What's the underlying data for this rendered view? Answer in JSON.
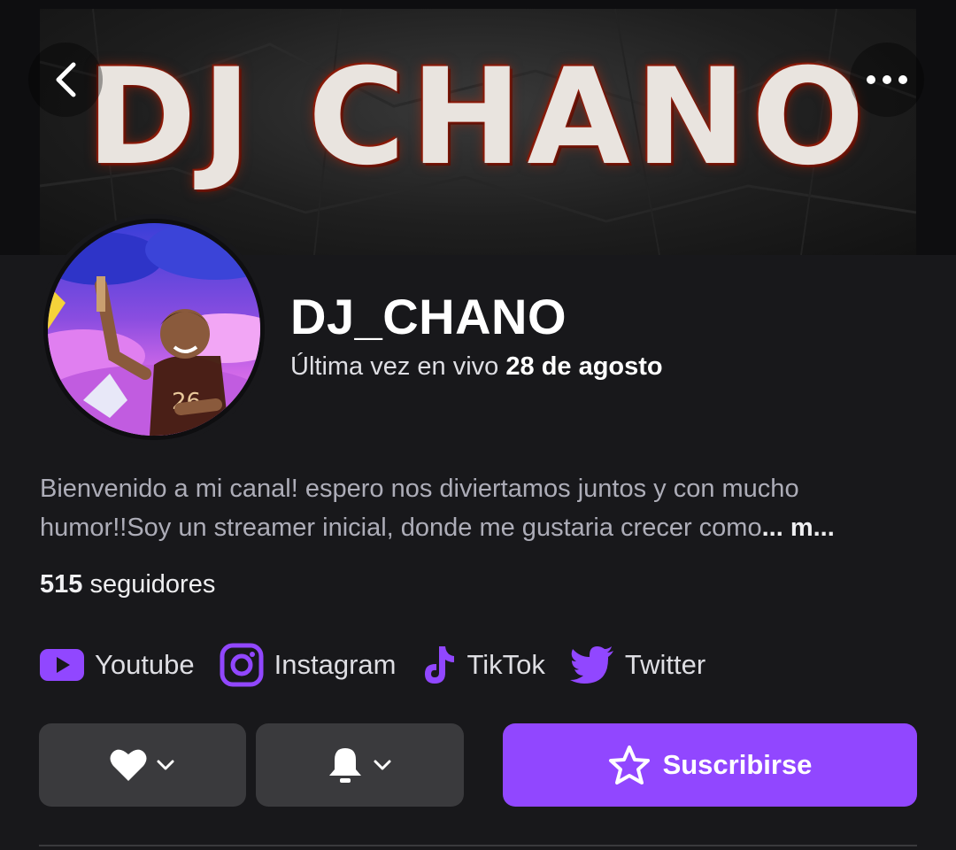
{
  "banner": {
    "text": "DJ CHANO"
  },
  "nav": {
    "back_icon": "chevron-left-icon",
    "more_icon": "more-horizontal-icon"
  },
  "profile": {
    "name": "DJ_CHANO",
    "last_live_prefix": "Última vez en vivo",
    "last_live_date": "28 de agosto"
  },
  "bio": {
    "line1": "Bienvenido a mi canal! espero nos diviertamos juntos y con mucho",
    "line2": "humor!!Soy un streamer inicial, donde me gustaria crecer como",
    "more": "... m..."
  },
  "followers": {
    "count": "515",
    "label": "seguidores"
  },
  "socials": [
    {
      "label": "Youtube",
      "icon": "youtube-icon"
    },
    {
      "label": "Instagram",
      "icon": "instagram-icon"
    },
    {
      "label": "TikTok",
      "icon": "tiktok-icon"
    },
    {
      "label": "Twitter",
      "icon": "twitter-icon"
    }
  ],
  "actions": {
    "subscribe_label": "Suscribirse",
    "follow_icon": "heart-icon",
    "notify_icon": "bell-icon"
  },
  "colors": {
    "accent": "#9147ff",
    "background": "#18181b",
    "button": "#3a3a3d"
  }
}
